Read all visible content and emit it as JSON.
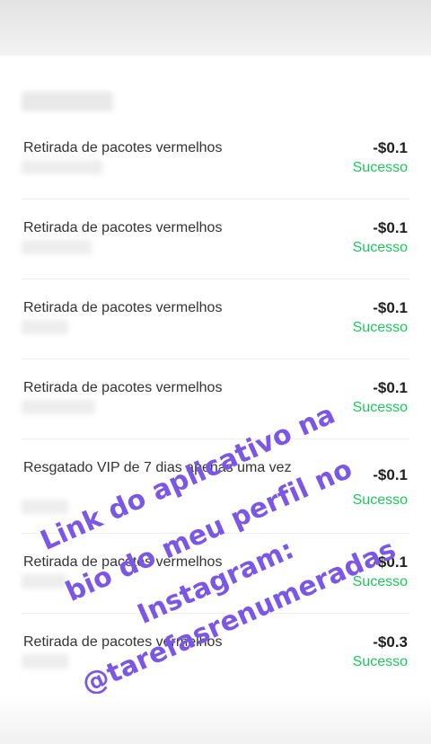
{
  "transactions": [
    {
      "title": "Retirada de pacotes vermelhos",
      "amount": "-$0.1",
      "status": "Sucesso"
    },
    {
      "title": "Retirada de pacotes vermelhos",
      "amount": "-$0.1",
      "status": "Sucesso"
    },
    {
      "title": "Retirada de pacotes vermelhos",
      "amount": "-$0.1",
      "status": "Sucesso"
    },
    {
      "title": "Retirada de pacotes vermelhos",
      "amount": "-$0.1",
      "status": "Sucesso"
    },
    {
      "title": "Resgatado VIP de 7 dias apenas uma vez",
      "amount": "-$0.1",
      "status": "Sucesso"
    },
    {
      "title": "Retirada de pacotes vermelhos",
      "amount": "-$0.1",
      "status": "Sucesso"
    },
    {
      "title": "Retirada de pacotes vermelhos",
      "amount": "-$0.3",
      "status": "Sucesso"
    }
  ],
  "overlay": {
    "line1": "Link do aplicativo na",
    "line2": "bio do meu perfil no",
    "line3": "Instagram:",
    "line4": "@tarefasrenumeradas",
    "color": "#7b57e6"
  },
  "colors": {
    "success": "#22c55e",
    "amount": "#1f1f1f"
  }
}
